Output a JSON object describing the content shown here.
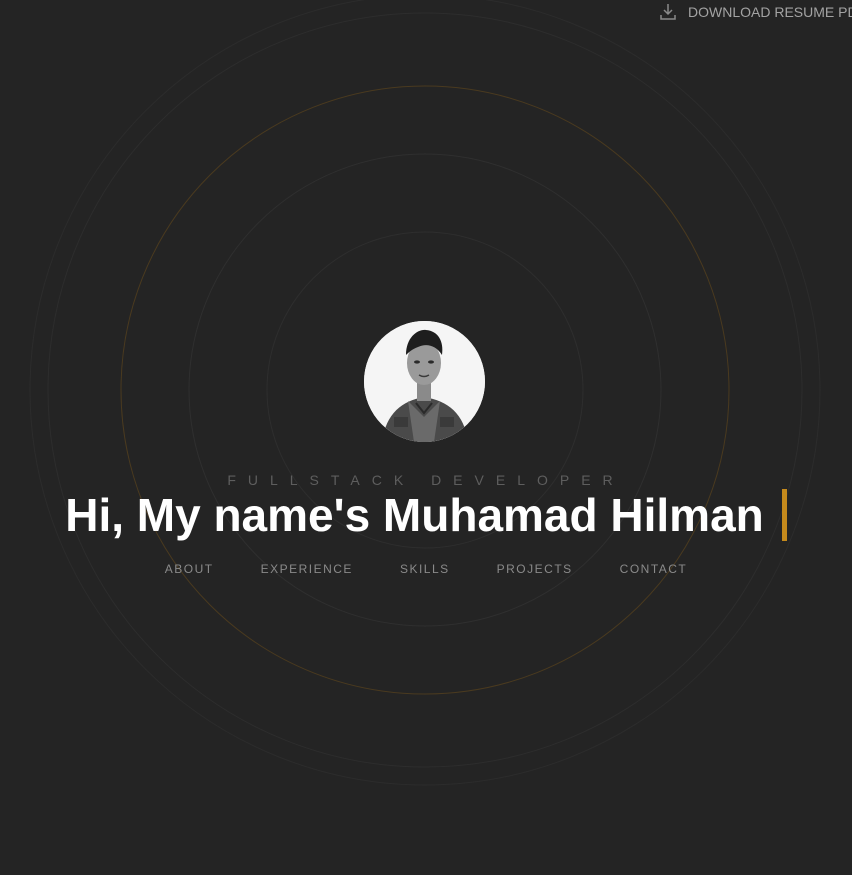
{
  "header": {
    "download_label": "DOWNLOAD RESUME PDF",
    "download_icon": "download-icon"
  },
  "hero": {
    "role": "FULLSTACK DEVELOPER",
    "greeting": "Hi, My name's Muhamad Hilman",
    "avatar_alt": "profile-photo"
  },
  "nav": {
    "items": [
      "ABOUT",
      "EXPERIENCE",
      "SKILLS",
      "PROJECTS",
      "CONTACT"
    ]
  },
  "colors": {
    "background": "#242424",
    "accent": "#c58a1c",
    "ring": "#2f2f2f",
    "accent_ring": "#4a3a1f"
  }
}
